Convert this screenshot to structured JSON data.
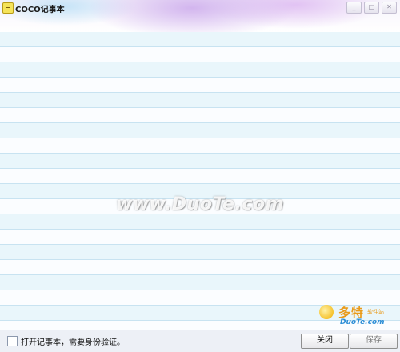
{
  "window": {
    "title": "COCO记事本",
    "min_glyph": "_",
    "max_glyph": "□",
    "close_glyph": "✕"
  },
  "note": {
    "watermark": "www.DuoTe.com"
  },
  "logo": {
    "big": "多特",
    "small": "软件站",
    "domain": "DuoTe.com"
  },
  "footer": {
    "auth_label": "打开记事本，需要身份验证。",
    "close_label": "关闭",
    "save_label": "保存"
  }
}
